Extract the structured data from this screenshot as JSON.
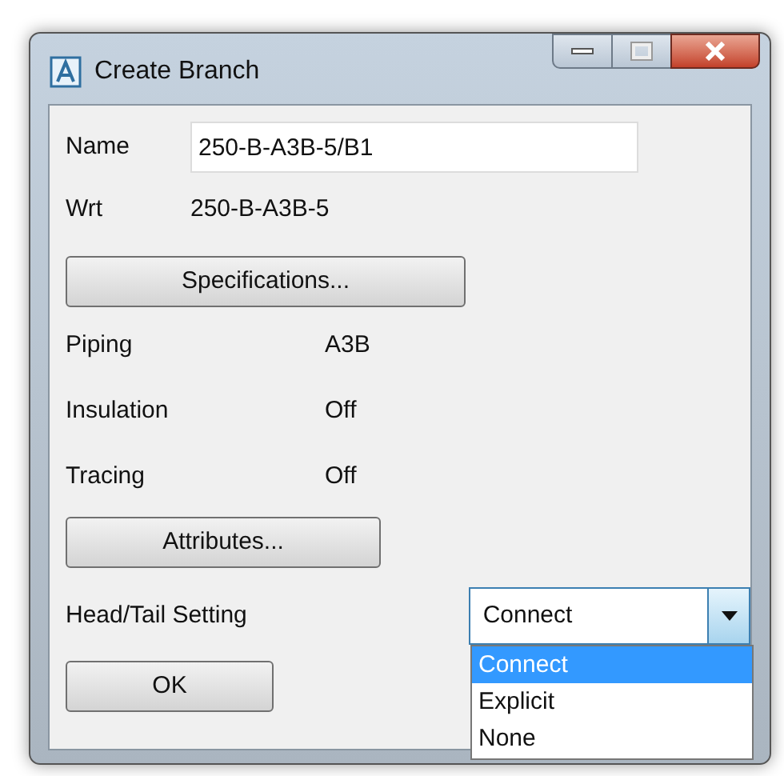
{
  "window": {
    "title": "Create Branch"
  },
  "name": {
    "label": "Name",
    "value": "250-B-A3B-5/B1"
  },
  "wrt": {
    "label": "Wrt",
    "value": "250-B-A3B-5"
  },
  "specifications_button": "Specifications...",
  "properties": [
    {
      "label": "Piping",
      "value": "A3B"
    },
    {
      "label": "Insulation",
      "value": "Off"
    },
    {
      "label": "Tracing",
      "value": "Off"
    }
  ],
  "attributes_button": "Attributes...",
  "head_tail": {
    "label": "Head/Tail Setting",
    "value": "Connect",
    "expanded": true,
    "options": [
      {
        "label": "Connect",
        "selected": true
      },
      {
        "label": "Explicit",
        "selected": false
      },
      {
        "label": "None",
        "selected": false
      }
    ]
  },
  "ok_button": "OK"
}
